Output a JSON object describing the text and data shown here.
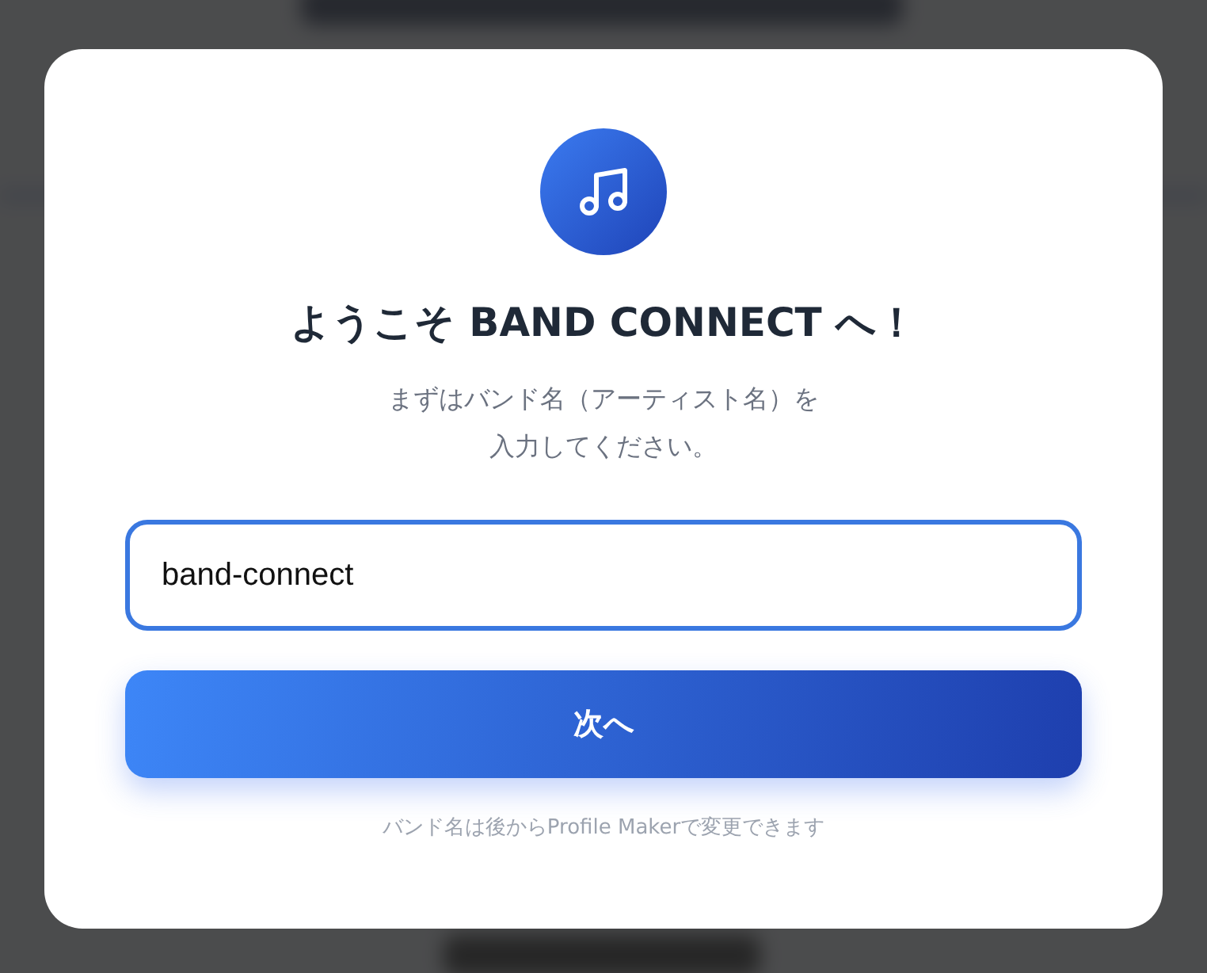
{
  "dialog": {
    "title": "ようこそ BAND CONNECT へ！",
    "description_lines": [
      "まずはバンド名（アーティスト名）を",
      "入力してください。"
    ],
    "band_name_field": {
      "value": "band-connect"
    },
    "next_button": {
      "label": "次へ"
    },
    "note": "バンド名は後からProfile Makerで変更できます"
  }
}
